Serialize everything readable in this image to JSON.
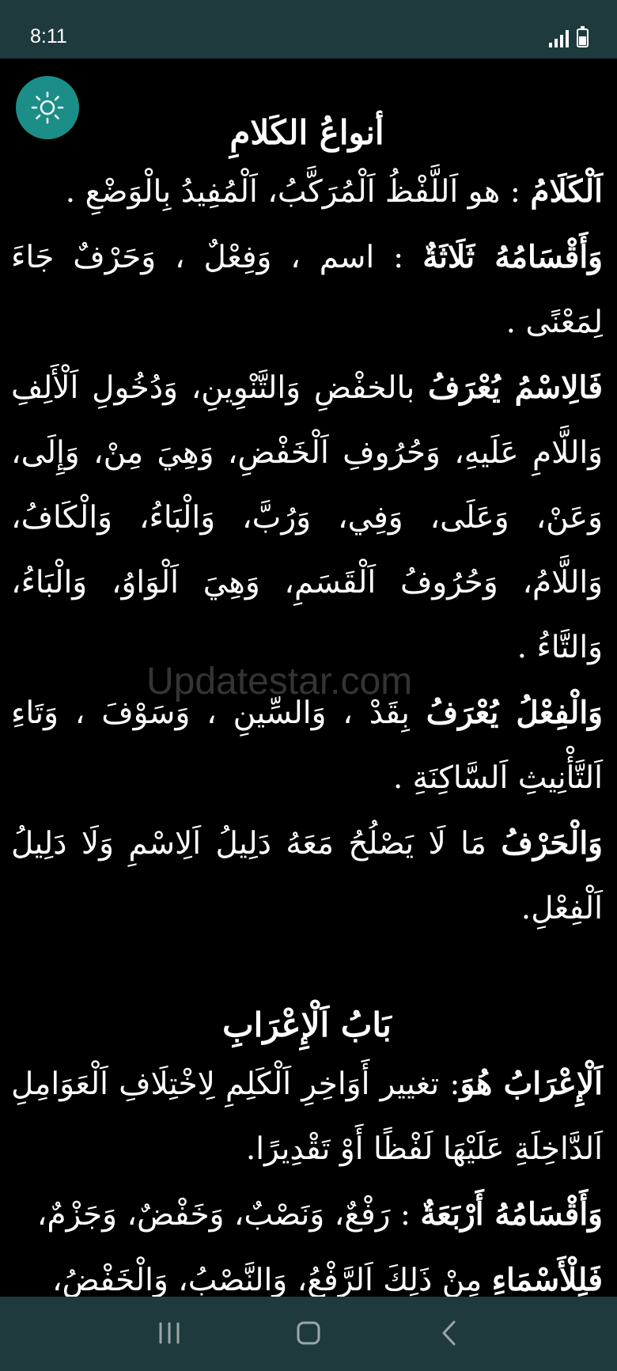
{
  "status_bar": {
    "time": "8:11"
  },
  "sections": [
    {
      "title": "أنواعُ الكَلامِ",
      "paragraphs": [
        {
          "label": "اَلْكَلَامُ",
          "text": " : هو اَللَّفْظُ اَلْمُرَكَّبُ، اَلْمُفِيدُ بِالْوَضْعِ ."
        },
        {
          "label": "وَأَقْسَامُهُ ثَلَاثَةٌ",
          "text": " : اسم ، وَفِعْلٌ ، وَحَرْفٌ جَاءَ لِمَعْنًى ."
        },
        {
          "label": "فَالِاسْمُ يُعْرَفُ",
          "text": " بالخفْضِ وَالتَّنْوِينِ، وَدُخُولِ اَلْأَلِفِ وَاللَّامِ عَلَيهِ، وَحُرُوفِ اَلْخَفْضِ، وَهِيَ مِنْ، وَإِلَى، وَعَنْ، وَعَلَى، وَفِي، وَرُبَّ، وَالْبَاءُ، وَالْكَافُ، وَاللَّامُ، وَحُرُوفُ اَلْقَسَمِ، وَهِيَ اَلْوَاوُ، وَالْبَاءُ، وَالتَّاءُ ."
        },
        {
          "label": "وَالْفِعْلُ يُعْرَفُ",
          "text": " بِقَدْ ، وَالسِّينِ ، وَسَوْفَ ، وَتَاءِ اَلتَّأْنِيثِ اَلسَّاكِنَةِ ."
        },
        {
          "label": "وَالْحَرْفُ",
          "text": " مَا لَا يَصْلُحُ مَعَهُ دَلِيلُ اَلِاسْمِ وَلَا دَلِيلُ اَلْفِعْلِ."
        }
      ]
    },
    {
      "title": "بَابُ اَلْإِعْرَابِ",
      "paragraphs": [
        {
          "label": "اَلْإِعْرَابُ هُوَ",
          "text": ": تغيير أَوَاخِرِ اَلْكَلِمِ لِاخْتِلَافِ اَلْعَوَامِلِ اَلدَّاخِلَةِ عَلَيْهَا لَفْظًا أَوْ تَقْدِيرًا."
        },
        {
          "label": "وَأَقْسَامُهُ أَرْبَعَةٌ",
          "text": " : رَفْعٌ، وَنَصْبٌ، وَخَفْضٌ، وَجَزْمٌ،"
        },
        {
          "label": "فَلِلْأَسْمَاءِ",
          "text": " مِنْ ذَلِكَ اَلرَّفْعُ، وَالنَّصْبُ، وَالْخَفْضُ،"
        }
      ]
    }
  ],
  "watermark": "Updatestar.com",
  "icons": {
    "theme": "sun-icon",
    "recents": "recents-icon",
    "home": "home-icon",
    "back": "back-icon"
  },
  "colors": {
    "bars": "#1f3a3d",
    "accent": "#1b8f87",
    "background": "#000000",
    "text": "#ffffff"
  }
}
